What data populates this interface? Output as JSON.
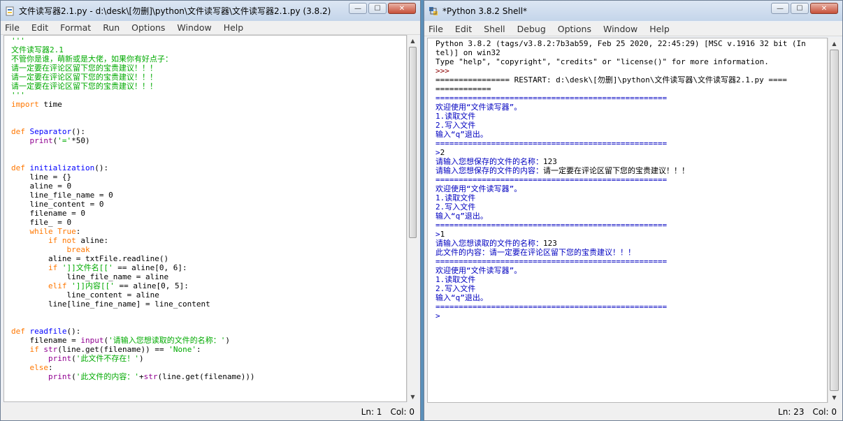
{
  "editor": {
    "title": "文件读写器2.1.py - d:\\desk\\[勿删]\\python\\文件读写器\\文件读写器2.1.py (3.8.2)",
    "menu": [
      "File",
      "Edit",
      "Format",
      "Run",
      "Options",
      "Window",
      "Help"
    ],
    "status": {
      "line": "Ln: 1",
      "col": "Col: 0"
    }
  },
  "shell": {
    "title": "*Python 3.8.2 Shell*",
    "menu": [
      "File",
      "Edit",
      "Shell",
      "Debug",
      "Options",
      "Window",
      "Help"
    ],
    "status": {
      "line": "Ln: 23",
      "col": "Col: 0"
    }
  },
  "window_controls": {
    "minimize": "—",
    "maximize": "☐",
    "close": "✕"
  }
}
